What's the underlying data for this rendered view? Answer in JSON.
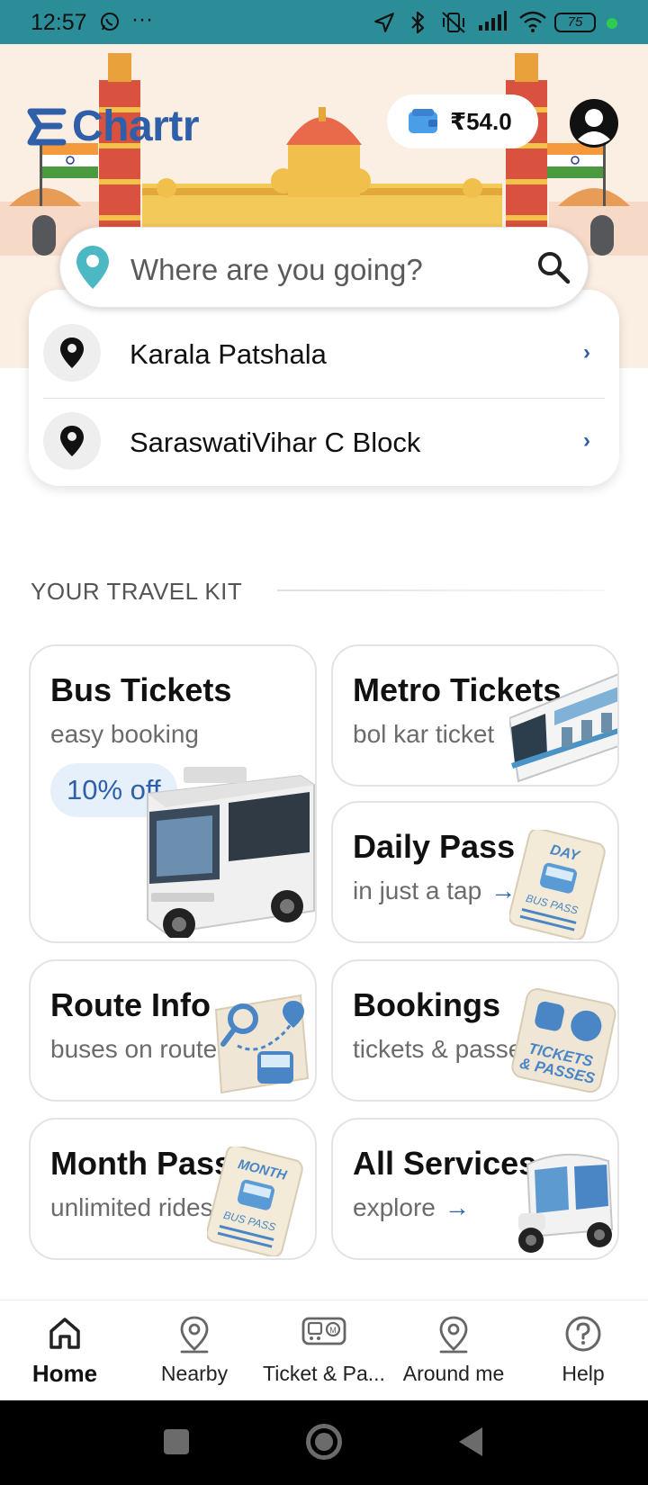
{
  "status_bar": {
    "time": "12:57",
    "battery": "75",
    "icons": [
      "whatsapp-icon",
      "more-icon",
      "location-arrow-icon",
      "bluetooth-icon",
      "vibrate-off-icon",
      "signal-icon",
      "wifi-icon",
      "battery-icon"
    ]
  },
  "header": {
    "logo": "Chartr",
    "wallet_amount": "₹54.0"
  },
  "search": {
    "placeholder": "Where are you going?"
  },
  "recent_places": [
    {
      "label": "Karala Patshala"
    },
    {
      "label": "SaraswatiVihar C Block"
    }
  ],
  "travel_kit": {
    "title": "YOUR TRAVEL KIT",
    "cards": {
      "bus": {
        "title": "Bus Tickets",
        "subtitle": "easy booking",
        "badge": "10% off"
      },
      "metro": {
        "title": "Metro Tickets",
        "subtitle": "bol kar ticket"
      },
      "daily": {
        "title": "Daily Pass",
        "subtitle": "in just a tap",
        "illustration_text": [
          "DAY",
          "BUS PASS"
        ]
      },
      "route": {
        "title": "Route Info",
        "subtitle": "buses on route"
      },
      "bookings": {
        "title": "Bookings",
        "subtitle": "tickets & passes",
        "illustration_text": [
          "TICKETS",
          "& PASSES"
        ]
      },
      "month": {
        "title": "Month Pass",
        "subtitle": "unlimited rides",
        "illustration_text": [
          "MONTH",
          "BUS PASS"
        ]
      },
      "all": {
        "title": "All Services",
        "subtitle": "explore"
      }
    }
  },
  "bottom_nav": [
    {
      "label": "Home",
      "icon": "home-icon",
      "active": true
    },
    {
      "label": "Nearby",
      "icon": "location-pin-icon",
      "active": false
    },
    {
      "label": "Ticket & Pa...",
      "icon": "bus-metro-ticket-icon",
      "active": false
    },
    {
      "label": "Around me",
      "icon": "location-pin-icon",
      "active": false
    },
    {
      "label": "Help",
      "icon": "help-icon",
      "active": false
    }
  ],
  "colors": {
    "status_bar": "#2b8d98",
    "brand_blue": "#2f5fa8",
    "banner_bg": "#fbeee2",
    "teal_pin": "#4cb8c4"
  }
}
